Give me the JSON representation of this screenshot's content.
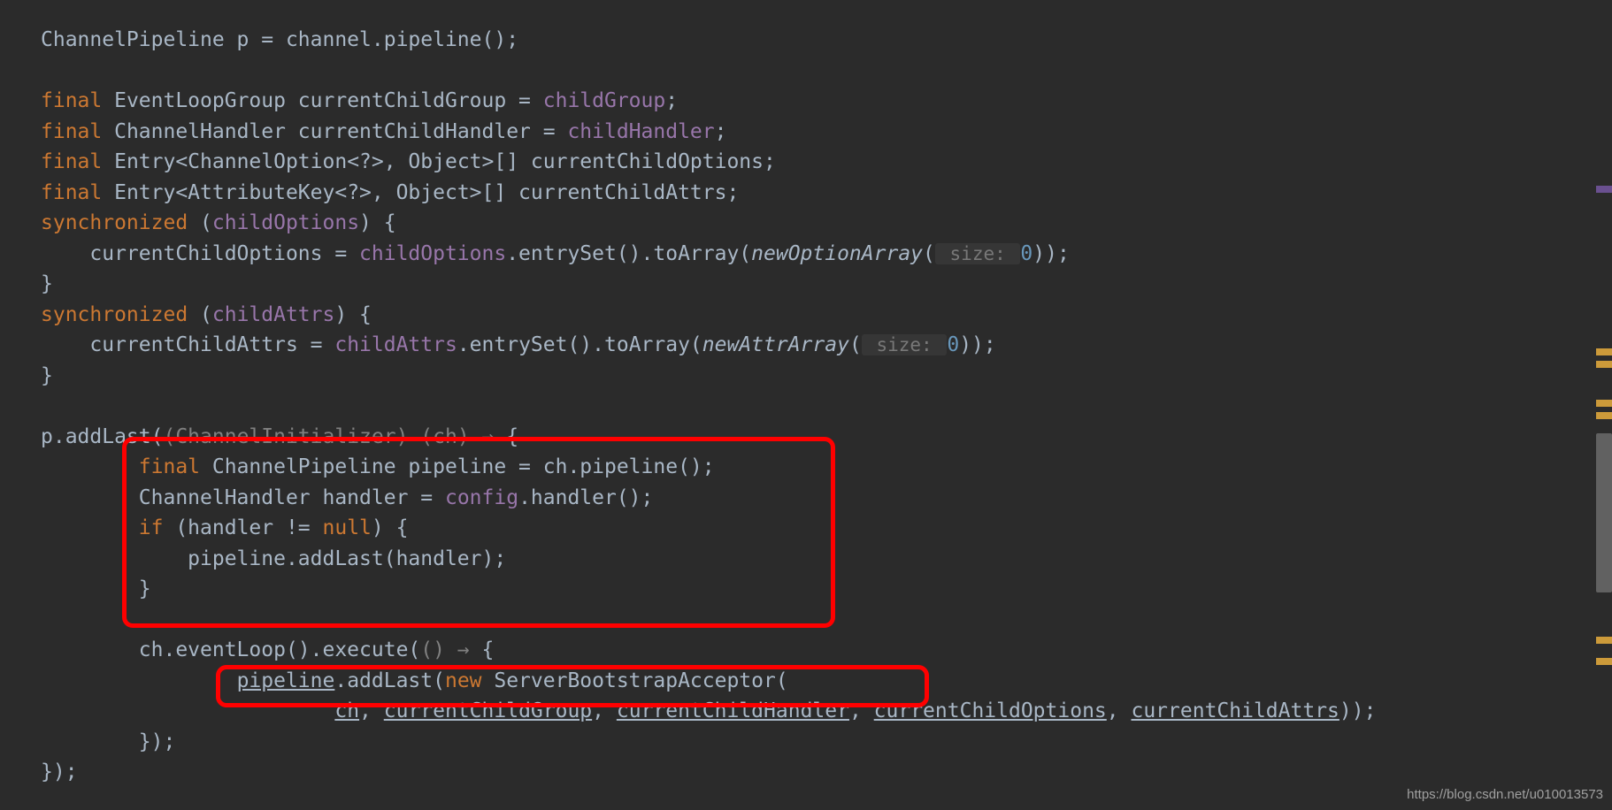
{
  "code": {
    "l1_a": "ChannelPipeline p = channel.pipeline();",
    "l3_kw": "final",
    "l3_rest": " EventLoopGroup currentChildGroup = ",
    "l3_field": "childGroup",
    "l3_end": ";",
    "l4_kw": "final",
    "l4_rest": " ChannelHandler currentChildHandler = ",
    "l4_field": "childHandler",
    "l4_end": ";",
    "l5_kw": "final",
    "l5_rest": " Entry<ChannelOption<?>, Object>[] currentChildOptions;",
    "l6_kw": "final",
    "l6_rest": " Entry<AttributeKey<?>, Object>[] currentChildAttrs;",
    "l7_kw": "synchronized",
    "l7_rest": " (",
    "l7_field": "childOptions",
    "l7_end": ") {",
    "l8_a": "    currentChildOptions = ",
    "l8_field": "childOptions",
    "l8_b": ".entrySet().toArray(",
    "l8_italic": "newOptionArray",
    "l8_c": "(",
    "l8_hint": " size: ",
    "l8_num": "0",
    "l8_d": "));",
    "l9": "}",
    "l10_kw": "synchronized",
    "l10_rest": " (",
    "l10_field": "childAttrs",
    "l10_end": ") {",
    "l11_a": "    currentChildAttrs = ",
    "l11_field": "childAttrs",
    "l11_b": ".entrySet().toArray(",
    "l11_italic": "newAttrArray",
    "l11_c": "(",
    "l11_hint": " size: ",
    "l11_num": "0",
    "l11_d": "));",
    "l12": "}",
    "l14_a": "p.addLast(",
    "l14_gray": "(ChannelInitializer) (ch) → ",
    "l14_b": "{",
    "l15_kw": "final",
    "l15_rest": " ChannelPipeline pipeline = ch.pipeline();",
    "l16_a": "        ChannelHandler handler = ",
    "l16_field": "config",
    "l16_b": ".handler();",
    "l17_kw": "if",
    "l17_rest": " (handler != ",
    "l17_null": "null",
    "l17_end": ") {",
    "l18": "            pipeline.addLast(handler);",
    "l19": "        }",
    "l21_a": "        ch.eventLoop().execute(",
    "l21_gray": "() → ",
    "l21_b": "{",
    "l22_a": "                ",
    "l22_u1": "pipeline",
    "l22_b": ".addLast(",
    "l22_kw": "new",
    "l22_c": " ServerBootstrapAcceptor(",
    "l23_a": "                        ",
    "l23_u1": "ch",
    "l23_s1": ", ",
    "l23_u2": "currentChildGroup",
    "l23_s2": ", ",
    "l23_u3": "currentChildHandler",
    "l23_s3": ", ",
    "l23_u4": "currentChildOptions",
    "l23_s4": ", ",
    "l23_u5": "currentChildAttrs",
    "l23_end": "));",
    "l24": "        });",
    "l25": "});"
  },
  "watermark": "https://blog.csdn.net/u010013573"
}
